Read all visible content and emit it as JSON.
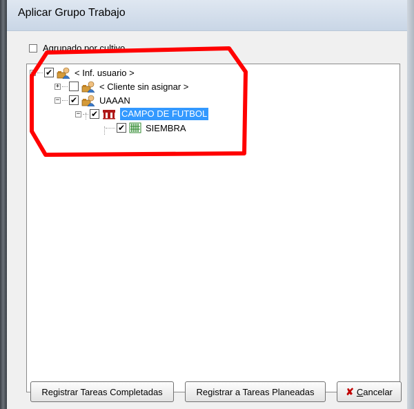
{
  "window": {
    "title": "Aplicar Grupo Trabajo"
  },
  "group_by_crop": {
    "label": "Agrupado por cultivo",
    "checked": false
  },
  "tree": {
    "nodes": [
      {
        "label": "< Inf. usuario >",
        "checked": true,
        "expanded": true,
        "icon": "user-icon"
      },
      {
        "label": "< Cliente sin asignar >",
        "checked": false,
        "expanded": false,
        "icon": "user-icon"
      },
      {
        "label": "UAAAN",
        "checked": true,
        "expanded": true,
        "icon": "user-icon"
      },
      {
        "label": "CAMPO DE FUTBOL",
        "checked": true,
        "expanded": true,
        "icon": "field-icon",
        "selected": true
      },
      {
        "label": "SIEMBRA",
        "checked": true,
        "icon": "crop-icon"
      }
    ]
  },
  "buttons": {
    "register_completed": "Registrar Tareas Completadas",
    "register_planned": "Registrar a Tareas Planeadas",
    "cancel": "Cancelar"
  },
  "colors": {
    "selection": "#3399ff",
    "annotation": "#ff0000",
    "cancel_icon": "#c00000"
  }
}
